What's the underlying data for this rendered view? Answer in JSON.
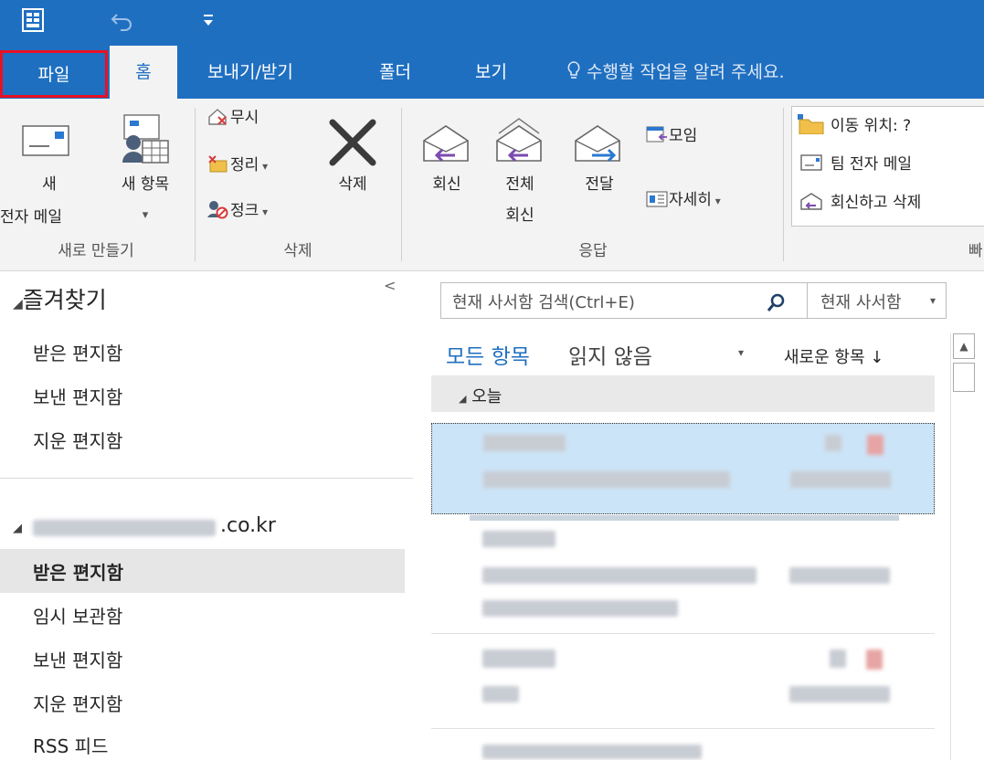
{
  "tabs": [
    "파일",
    "홈",
    "보내기/받기",
    "폴더",
    "보기"
  ],
  "tell_me": "수행할 작업을 알려 주세요.",
  "ribbon": {
    "new_group": {
      "new_mail_line1": "새",
      "new_mail_line2": "전자 메일",
      "new_items": "새 항목",
      "label": "새로 만들기"
    },
    "delete_group": {
      "ignore": "무시",
      "cleanup": "정리",
      "junk": "정크",
      "delete": "삭제",
      "label": "삭제"
    },
    "respond_group": {
      "reply": "회신",
      "reply_all_line1": "전체",
      "reply_all_line2": "회신",
      "forward": "전달",
      "meeting": "모임",
      "more": "자세히",
      "label": "응답"
    },
    "quick_steps": {
      "move_to": "이동 위치: ?",
      "team_email": "팀 전자 메일",
      "reply_delete": "회신하고 삭제",
      "label_partial": "빠"
    }
  },
  "nav": {
    "favorites_header": "즐겨찾기",
    "favorites": [
      "받은 편지함",
      "보낸 편지함",
      "지운 편지함"
    ],
    "account_suffix": ".co.kr",
    "account_items": [
      "받은 편지함",
      "임시 보관함",
      "보낸 편지함",
      "지운 편지함",
      "RSS 피드"
    ]
  },
  "search": {
    "placeholder": "현재 사서함 검색(Ctrl+E)",
    "scope": "현재 사서함"
  },
  "filters": {
    "all": "모든 항목",
    "unread": "읽지 않음",
    "sort": "새로운 항목 ↓"
  },
  "group_today": "오늘"
}
